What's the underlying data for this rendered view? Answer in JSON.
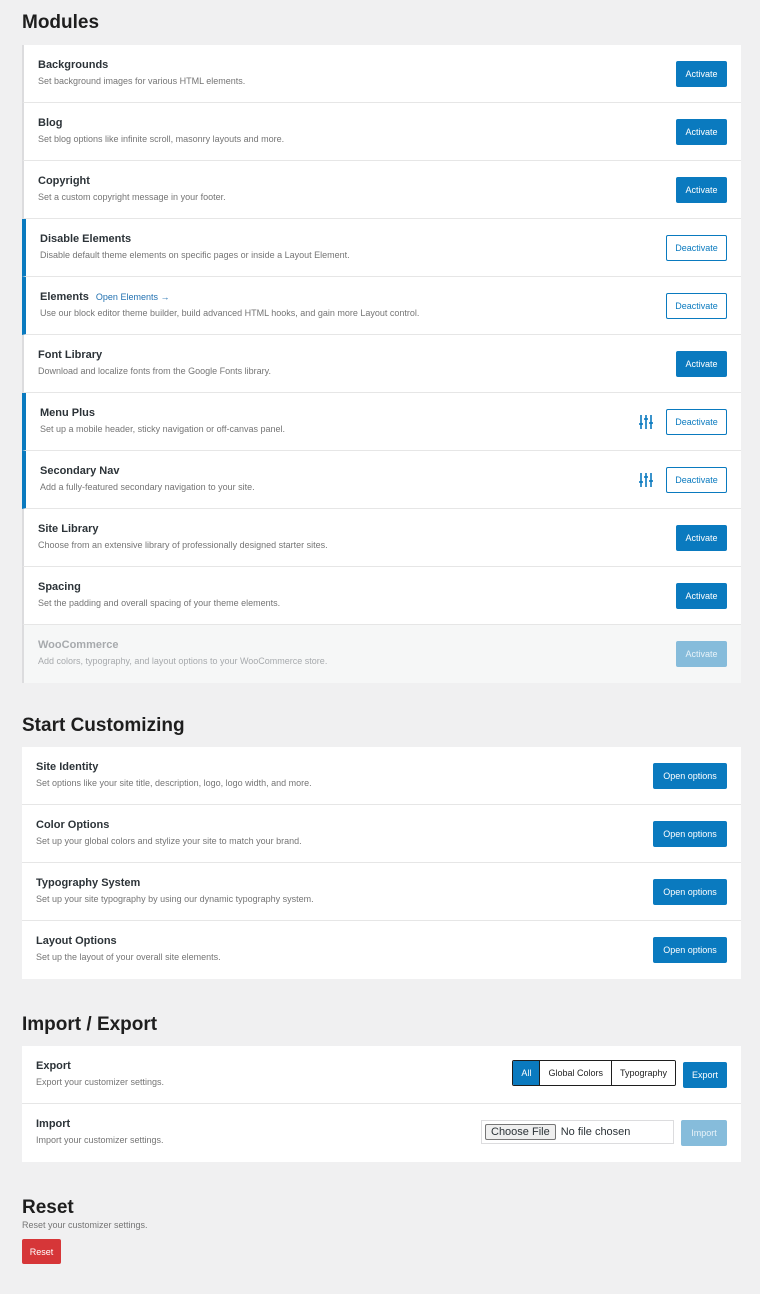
{
  "modules": {
    "title": "Modules",
    "rows": [
      {
        "title": "Backgrounds",
        "desc": "Set background images for various HTML elements.",
        "button": "Activate"
      },
      {
        "title": "Blog",
        "desc": "Set blog options like infinite scroll, masonry layouts and more.",
        "button": "Activate"
      },
      {
        "title": "Copyright",
        "desc": "Set a custom copyright message in your footer.",
        "button": "Activate"
      },
      {
        "title": "Disable Elements",
        "desc": "Disable default theme elements on specific pages or inside a Layout Element.",
        "button": "Deactivate"
      },
      {
        "title": "Elements",
        "link": "Open Elements →",
        "desc": "Use our block editor theme builder, build advanced HTML hooks, and gain more Layout control.",
        "button": "Deactivate"
      },
      {
        "title": "Font Library",
        "desc": "Download and localize fonts from the Google Fonts library.",
        "button": "Activate"
      },
      {
        "title": "Menu Plus",
        "desc": "Set up a mobile header, sticky navigation or off-canvas panel.",
        "button": "Deactivate",
        "icon": "sliders-icon"
      },
      {
        "title": "Secondary Nav",
        "desc": "Add a fully-featured secondary navigation to your site.",
        "button": "Deactivate",
        "icon": "sliders-icon"
      },
      {
        "title": "Site Library",
        "desc": "Choose from an extensive library of professionally designed starter sites.",
        "button": "Activate"
      },
      {
        "title": "Spacing",
        "desc": "Set the padding and overall spacing of your theme elements.",
        "button": "Activate"
      },
      {
        "title": "WooCommerce",
        "desc": "Add colors, typography, and layout options to your WooCommerce store.",
        "button": "Activate"
      }
    ]
  },
  "customizing": {
    "title": "Start Customizing",
    "rows": [
      {
        "title": "Site Identity",
        "desc": "Set options like your site title, description, logo, logo width, and more.",
        "button": "Open options"
      },
      {
        "title": "Color Options",
        "desc": "Set up your global colors and stylize your site to match your brand.",
        "button": "Open options"
      },
      {
        "title": "Typography System",
        "desc": "Set up your site typography by using our dynamic typography system.",
        "button": "Open options"
      },
      {
        "title": "Layout Options",
        "desc": "Set up the layout of your overall site elements.",
        "button": "Open options"
      }
    ]
  },
  "import_export": {
    "title": "Import / Export",
    "export": {
      "title": "Export",
      "desc": "Export your customizer settings.",
      "options": [
        "All",
        "Global Colors",
        "Typography"
      ],
      "selected": "All",
      "button": "Export"
    },
    "import": {
      "title": "Import",
      "desc": "Import your customizer settings.",
      "file_button": "Choose File",
      "file_status": "No file chosen",
      "button": "Import"
    }
  },
  "reset": {
    "title": "Reset",
    "desc": "Reset your customizer settings.",
    "button": "Reset"
  },
  "colors": {
    "accent": "#0a7abf",
    "danger": "#d63638",
    "background": "#f0f0f1"
  }
}
